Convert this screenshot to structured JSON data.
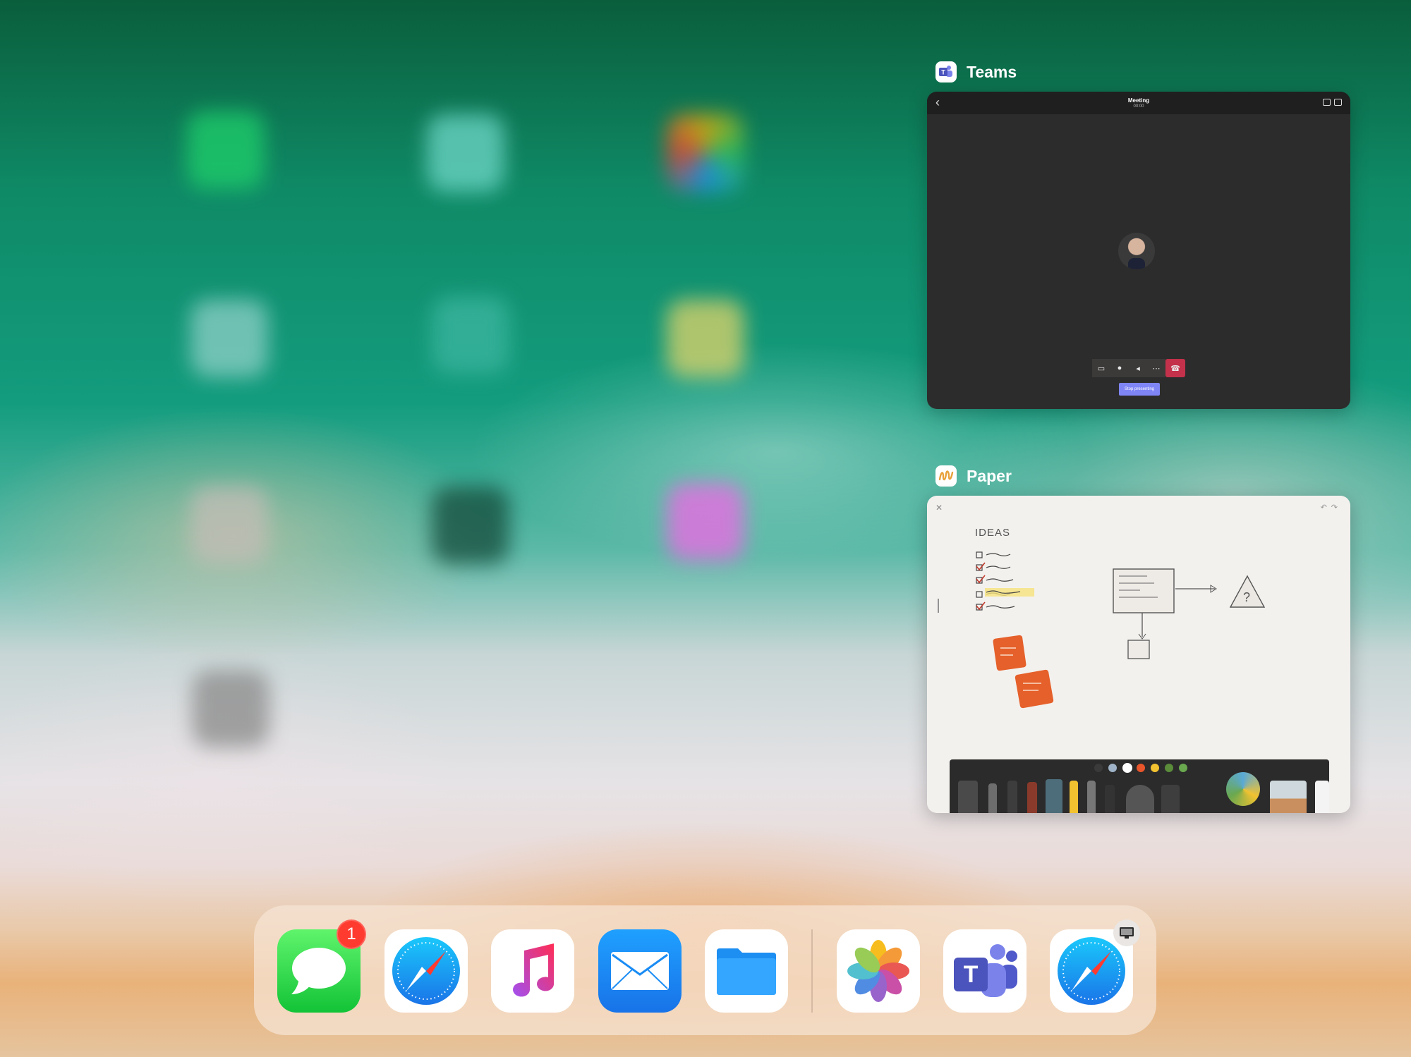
{
  "switcher": {
    "apps": [
      {
        "name": "Teams",
        "preview": {
          "title": "Meeting",
          "subtitle": "00:00",
          "stop_label": "Stop presenting",
          "controls": [
            "video-off-icon",
            "mic-icon",
            "speaker-icon",
            "more-icon",
            "hang-up-icon"
          ]
        }
      },
      {
        "name": "Paper",
        "preview": {
          "heading": "IDEAS",
          "palette": [
            "#3a3a3a",
            "#9fb3c8",
            "#ffffff",
            "#e8552a",
            "#f2c230",
            "#5a8c3a",
            "#6aa84f"
          ]
        }
      }
    ]
  },
  "dock": {
    "apps": [
      {
        "name": "Messages",
        "icon": "messages-icon",
        "badge": "1"
      },
      {
        "name": "Safari",
        "icon": "safari-icon"
      },
      {
        "name": "Music",
        "icon": "music-icon"
      },
      {
        "name": "Mail",
        "icon": "mail-icon"
      },
      {
        "name": "Files",
        "icon": "files-icon"
      },
      {
        "name": "Photos",
        "icon": "photos-icon"
      },
      {
        "name": "Teams",
        "icon": "teams-icon"
      },
      {
        "name": "Safari",
        "icon": "safari-icon",
        "indicator": "display-icon"
      }
    ]
  }
}
